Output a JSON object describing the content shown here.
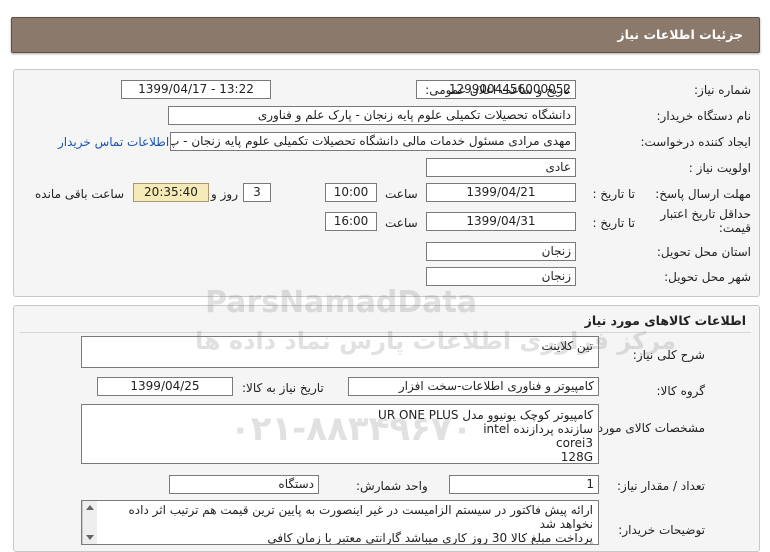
{
  "header": {
    "title": "جزئیات اطلاعات نیاز"
  },
  "need_info": {
    "need_number_label": "شماره نیاز:",
    "need_number": "1299004456000052",
    "announce_label": "تاریخ و ساعت اعلان عمومی:",
    "announce_value": "1399/04/17 - 13:22",
    "buyer_org_label": "نام دستگاه خریدار:",
    "buyer_org": "دانشگاه تحصیلات تکمیلی علوم پایه زنجان - پارک علم و فناوری",
    "requester_label": "ایجاد کننده درخواست:",
    "requester": "مهدی مرادی مسئول خدمات مالی دانشگاه تحصیلات تکمیلی علوم پایه زنجان - پ",
    "contact_link": "اطلاعات تماس خریدار",
    "priority_label": "اولویت نیاز :",
    "priority": "عادی",
    "deadline_label": "مهلت ارسال پاسخ:",
    "until_date_label": "تا تاریخ :",
    "deadline_date": "1399/04/21",
    "time_label": "ساعت",
    "deadline_time": "10:00",
    "days_value": "3",
    "days_label": "روز و",
    "remaining_time": "20:35:40",
    "remaining_label": "ساعت باقی مانده",
    "validity_label": "حداقل تاریخ اعتبار قیمت:",
    "validity_until_label": "تا تاریخ :",
    "validity_date": "1399/04/31",
    "validity_time_label": "ساعت",
    "validity_time": "16:00",
    "province_label": "استان محل تحویل:",
    "province": "زنجان",
    "city_label": "شهر محل تحویل:",
    "city": "زنجان"
  },
  "goods": {
    "section_title": "اطلاعات کالاهای مورد نیاز",
    "general_desc_label": "شرح کلی نیاز:",
    "general_desc": "تین کلاینت",
    "group_label": "گروه کالا:",
    "group": "کامپیوتر و فناوری اطلاعات-سخت افزار",
    "need_date_label": "تاریخ نیاز به کالا:",
    "need_date": "1399/04/25",
    "specs_label": "مشخصات کالای مورد نیاز:",
    "specs_lines": [
      "کامپیوتر کوچک یونیوو مدل UR ONE PLUS",
      "سازنده پردازنده intel",
      "corei3",
      "128G"
    ],
    "qty_label": "تعداد / مقدار نیاز:",
    "qty": "1",
    "unit_label": "واحد شمارش:",
    "unit": "دستگاه",
    "buyer_notes_label": "توضیحات خریدار:",
    "buyer_notes_lines": [
      "ارائه پیش فاکتور در سیستم الزامیست در غیر اینصورت به پایین ترین قیمت هم ترتیب اثر داده نخواهد شد",
      "پرداخت مبلغ کالا 30 روز کاری میباشد گارانتی معتبر با زمان کافی"
    ]
  },
  "watermark": {
    "line1": "ParsNamadData",
    "line2": "مرکز فراوری اطلاعات پارس نماد داده ها",
    "phone": "۰۲۱-۸۸۳۴۹۶۷۰"
  }
}
